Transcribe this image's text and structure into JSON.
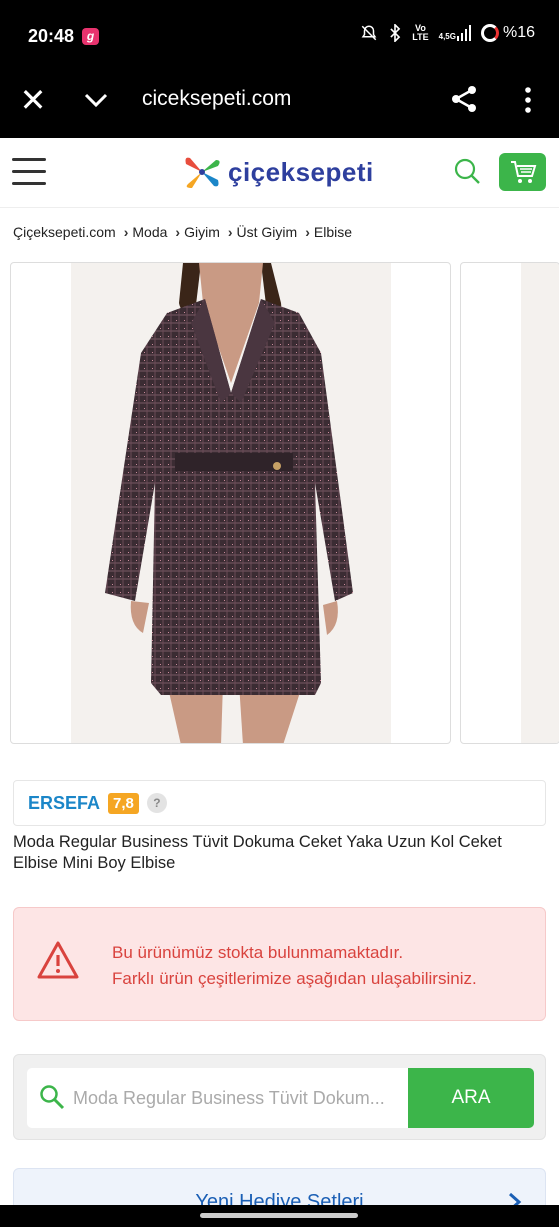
{
  "status_bar": {
    "time": "20:48",
    "app_badge": "g",
    "network_top": "Vo",
    "network_bottom": "LTE",
    "signal": "4,5G",
    "battery": "%16"
  },
  "browser": {
    "url": "ciceksepeti.com",
    "icons": [
      "close-icon",
      "chevron-down-icon",
      "share-icon",
      "more-vert-icon"
    ]
  },
  "header": {
    "logo_text": "çiçeksepeti",
    "accent_color": "#3cb54a",
    "logo_color": "#2e3f9e"
  },
  "breadcrumb": {
    "items": [
      "Çiçeksepeti.com",
      "Moda",
      "Giyim",
      "Üst Giyim",
      "Elbise"
    ]
  },
  "seller": {
    "name": "ERSEFA",
    "score": "7,8",
    "help": "?"
  },
  "product": {
    "title": "Moda Regular Business Tüvit Dokuma Ceket Yaka Uzun Kol Ceket Elbise Mini Boy Elbise"
  },
  "alert": {
    "line1": "Bu ürünümüz stokta bulunmamaktadır.",
    "line2": "Farklı ürün çeşitlerimize aşağıdan ulaşabilirsiniz.",
    "color": "#d9433e"
  },
  "search": {
    "placeholder": "Moda Regular Business Tüvit Dokum...",
    "button_label": "ARA"
  },
  "gift": {
    "title": "Yeni Hediye Setleri"
  }
}
